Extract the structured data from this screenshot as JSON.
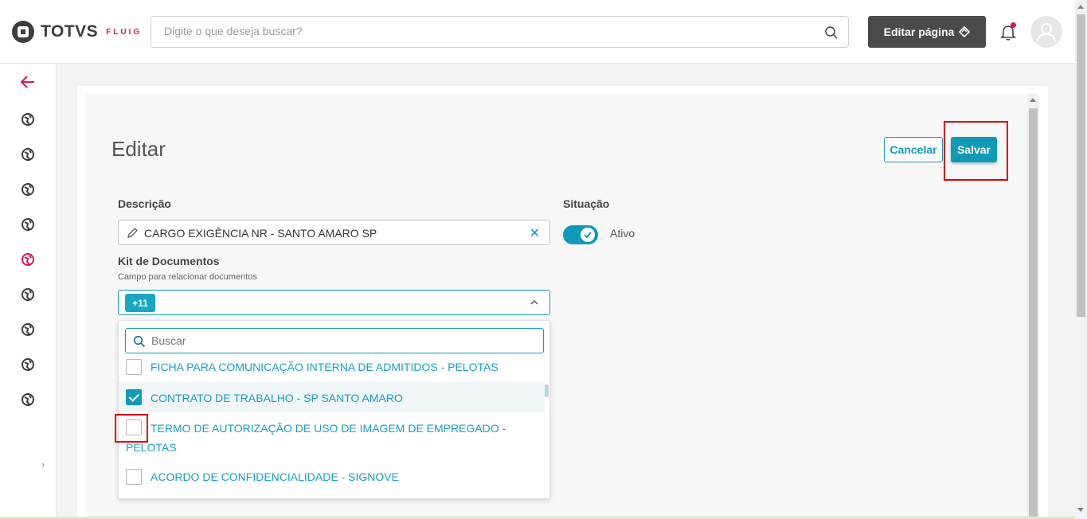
{
  "header": {
    "logo_text": "TOTVS",
    "logo_sub": "FLUIG",
    "search_placeholder": "Digite o que deseja buscar?",
    "edit_page_label": "Editar página"
  },
  "sidebar": {
    "items": [
      {
        "icon": "back-arrow-icon",
        "color": "#d0185c"
      },
      {
        "icon": "globe-icon"
      },
      {
        "icon": "globe-icon"
      },
      {
        "icon": "globe-icon"
      },
      {
        "icon": "globe-icon"
      },
      {
        "icon": "globe-icon",
        "active": true,
        "color": "#d0185c"
      },
      {
        "icon": "globe-icon"
      },
      {
        "icon": "globe-icon"
      },
      {
        "icon": "globe-icon"
      },
      {
        "icon": "globe-icon"
      }
    ]
  },
  "page": {
    "title": "Editar",
    "cancel_label": "Cancelar",
    "save_label": "Salvar"
  },
  "form": {
    "descricao_label": "Descrição",
    "descricao_value": "CARGO EXIGÊNCIA NR - SANTO AMARO SP",
    "situacao_label": "Situação",
    "situacao_value": "Ativo",
    "situacao_on": true,
    "kit_label": "Kit de Documentos",
    "kit_help": "Campo para relacionar documentos",
    "kit_tag": "+11",
    "dropdown_search_placeholder": "Buscar",
    "options": [
      {
        "label": "FICHA PARA COMUNICAÇÃO INTERNA DE ADMITIDOS - PELOTAS",
        "checked": false
      },
      {
        "label": "CONTRATO DE TRABALHO - SP SANTO AMARO",
        "checked": true
      },
      {
        "label": "TERMO DE AUTORIZAÇÃO DE USO DE IMAGEM DE EMPREGADO -",
        "label_cont": "PELOTAS",
        "checked": false
      },
      {
        "label": "ACORDO DE CONFIDENCIALIDADE - SIGNOVE",
        "checked": false
      }
    ]
  },
  "colors": {
    "accent": "#0f9ab8",
    "brand": "#d0185c",
    "highlight": "#e00000"
  }
}
